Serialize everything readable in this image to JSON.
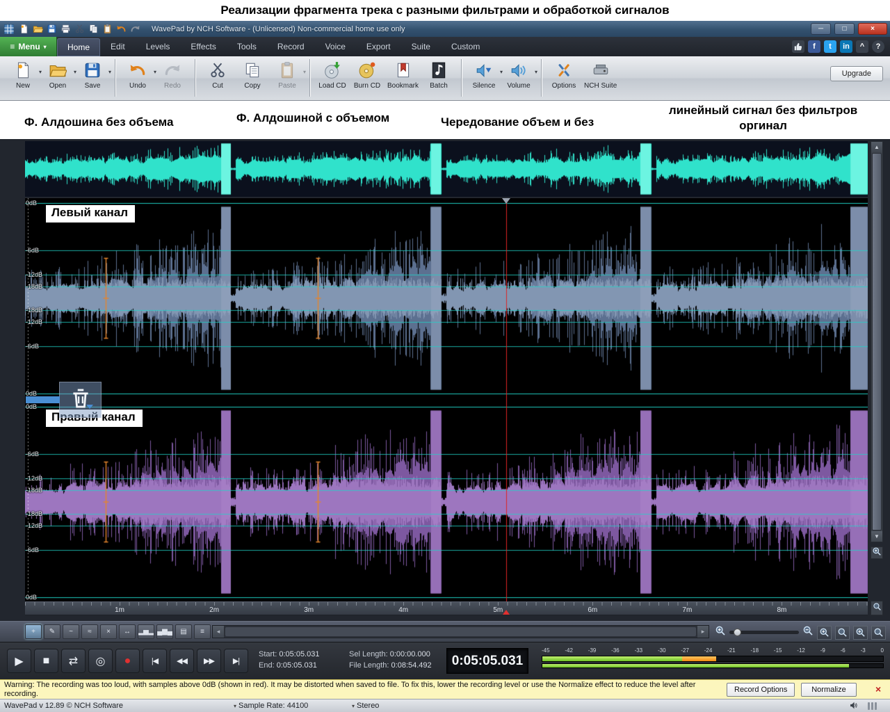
{
  "page_title": "Реализации фрагмента трека с разными фильтрами и обработкой сигналов",
  "window": {
    "title": "WavePad by NCH Software - (Unlicensed) Non-commercial home use only",
    "controls": {
      "minimize": "─",
      "maximize": "□",
      "close": "×"
    }
  },
  "glyphs": {
    "menu": "≡",
    "caret": "▾",
    "scroll_up": "▲",
    "scroll_down": "▼",
    "scroll_left": "◂",
    "scroll_right": "▸",
    "collapse": "^",
    "help": "?"
  },
  "menubar": {
    "menu_label": "Menu",
    "tabs": [
      {
        "label": "Home",
        "active": true
      },
      {
        "label": "Edit"
      },
      {
        "label": "Levels"
      },
      {
        "label": "Effects"
      },
      {
        "label": "Tools"
      },
      {
        "label": "Record"
      },
      {
        "label": "Voice"
      },
      {
        "label": "Export"
      },
      {
        "label": "Suite"
      },
      {
        "label": "Custom"
      }
    ],
    "social": [
      {
        "name": "like-icon",
        "svg": "thumb-up"
      },
      {
        "name": "facebook-icon",
        "glyph": "f",
        "color": "#3b5998"
      },
      {
        "name": "twitter-icon",
        "glyph": "t",
        "color": "#2aa3ef"
      },
      {
        "name": "linkedin-icon",
        "glyph": "in",
        "color": "#0a77b5"
      }
    ]
  },
  "quick_access": [
    "new-file",
    "open-folder",
    "save-disk",
    "print",
    "cut",
    "copy",
    "clipboard",
    "undo-arrow",
    "redo-arrow"
  ],
  "toolbar": {
    "groups": [
      {
        "items": [
          {
            "label": "New",
            "icon": "new-file",
            "dropdown": true
          },
          {
            "label": "Open",
            "icon": "open-folder",
            "dropdown": true
          },
          {
            "label": "Save",
            "icon": "save-disk",
            "dropdown": true
          }
        ]
      },
      {
        "items": [
          {
            "label": "Undo",
            "icon": "undo-arrow",
            "dropdown": true
          },
          {
            "label": "Redo",
            "icon": "redo-arrow",
            "disabled": true
          }
        ]
      },
      {
        "items": [
          {
            "label": "Cut",
            "icon": "cut"
          },
          {
            "label": "Copy",
            "icon": "copy"
          },
          {
            "label": "Paste",
            "icon": "clipboard",
            "dropdown": true,
            "disabled": true
          }
        ]
      },
      {
        "items": [
          {
            "label": "Load CD",
            "icon": "cd-load"
          },
          {
            "label": "Burn CD",
            "icon": "cd-burn"
          },
          {
            "label": "Bookmark",
            "icon": "bookmark"
          },
          {
            "label": "Batch",
            "icon": "batch-note"
          }
        ]
      },
      {
        "items": [
          {
            "label": "Silence",
            "icon": "silence-speaker",
            "dropdown": true
          },
          {
            "label": "Volume",
            "icon": "volume-wave",
            "dropdown": true
          }
        ]
      },
      {
        "items": [
          {
            "label": "Options",
            "icon": "options-tools"
          },
          {
            "label": "NCH Suite",
            "icon": "nch-suite"
          }
        ]
      }
    ],
    "upgrade_label": "Upgrade"
  },
  "annotations": [
    "Ф. Алдошина без объема",
    "Ф. Алдошиной с объемом",
    "Чередование объем и без",
    "линейный сигнал без фильтров",
    "оргинал"
  ],
  "editor": {
    "left_channel_label": "Левый канал",
    "right_channel_label": "Правый канал",
    "db_scale": [
      "0dB",
      "-6dB",
      "-12dB",
      "-18dB"
    ],
    "timeline_labels": [
      "1m",
      "2m",
      "3m",
      "4m",
      "5m",
      "6m",
      "7m",
      "8m"
    ],
    "waveform": {
      "overview_color": "#30e2cb",
      "overview_burst_color": "#6cf4e1",
      "left_spike_color": "#5c7090",
      "left_core_color": "#8296b2",
      "left_burst_color": "#97a6c0",
      "right_spike_color": "#7d58a0",
      "right_core_color": "#9d76bf",
      "right_burst_color": "#ab84ca",
      "grid_color": "#20d5c8",
      "playhead_color": "#dd2525",
      "marker_color": "#e5862e",
      "bursts": [
        [
          0.2327,
          0.2442
        ],
        [
          0.4818,
          0.4934
        ],
        [
          0.7302,
          0.7426
        ],
        [
          0.9795,
          0.9995
        ]
      ],
      "markers": [
        0.0957,
        0.3473
      ]
    }
  },
  "edit_tools": [
    {
      "name": "add-marker-tool",
      "glyph": "+",
      "active": true
    },
    {
      "name": "draw-tool",
      "glyph": "✎"
    },
    {
      "name": "smooth-tool",
      "glyph": "~"
    },
    {
      "name": "envelope-tool",
      "glyph": "≈"
    },
    {
      "name": "crossfade-tool",
      "glyph": "×"
    },
    {
      "name": "stretch-tool",
      "glyph": "↔"
    },
    {
      "name": "amplify-tool",
      "glyph": "▂▅▂"
    },
    {
      "name": "normalize-tool",
      "glyph": "▄▆▄"
    },
    {
      "name": "stats-tool",
      "glyph": "▤"
    },
    {
      "name": "list-tool",
      "glyph": "≡"
    }
  ],
  "transport": {
    "buttons": [
      {
        "name": "play",
        "glyph": "▶"
      },
      {
        "name": "stop",
        "glyph": "■"
      },
      {
        "name": "loop",
        "glyph": "⇄"
      },
      {
        "name": "record-monitor",
        "glyph": "◎"
      },
      {
        "name": "record",
        "glyph": "●",
        "color": "#e03030"
      },
      {
        "name": "skip-to-start",
        "glyph": "|◀",
        "small": true
      },
      {
        "name": "rewind",
        "glyph": "◀◀",
        "small": true
      },
      {
        "name": "fast-forward",
        "glyph": "▶▶",
        "small": true
      },
      {
        "name": "skip-to-end",
        "glyph": "▶|",
        "small": true
      }
    ]
  },
  "status_panel": {
    "start_label": "Start:",
    "start_value": "0:05:05.031",
    "end_label": "End:",
    "end_value": "0:05:05.031",
    "sel_label": "Sel Length:",
    "sel_value": "0:00:00.000",
    "file_label": "File Length:",
    "file_value": "0:08:54.492",
    "time_display": "0:05:05.031"
  },
  "meter": {
    "scale": [
      "-45",
      "-42",
      "-39",
      "-36",
      "-33",
      "-30",
      "-27",
      "-24",
      "-21",
      "-18",
      "-15",
      "-12",
      "-9",
      "-6",
      "-3",
      "0"
    ],
    "left": {
      "green_pct": 41,
      "orange_pct": 10
    },
    "right": {
      "green_pct": 90
    }
  },
  "warning": {
    "text": "Warning: The recording was too loud, with samples above 0dB (shown in red). It may be distorted when saved to file. To fix this, lower the recording level or use the Normalize effect to reduce the level after recording.",
    "record_options_label": "Record Options",
    "normalize_label": "Normalize",
    "close_glyph": "×"
  },
  "statusbar": {
    "version": "WavePad v 12.89 © NCH Software",
    "sample_rate": "Sample Rate: 44100",
    "channel_mode": "Stereo"
  }
}
